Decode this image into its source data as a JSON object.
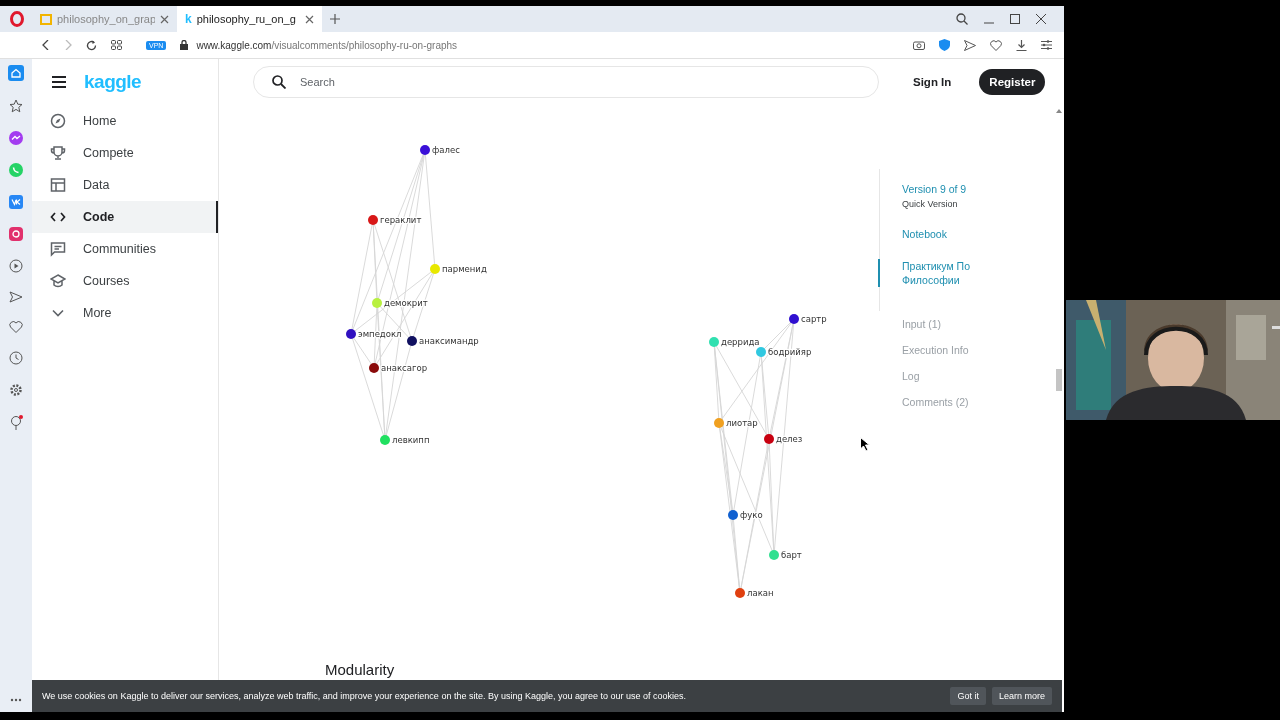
{
  "browser": {
    "tabs": [
      {
        "title": "philosophy_on_grap",
        "selected": false
      },
      {
        "title": "philosophy_ru_on_g",
        "selected": true,
        "favicon_letter": "k"
      }
    ],
    "vpn_badge": "VPN",
    "address": {
      "domain": "www.kaggle.com",
      "path": "/visualcomments/philosophy-ru-on-graphs"
    }
  },
  "kaggle": {
    "logo": "kaggle",
    "search": {
      "placeholder": "Search"
    },
    "sign_in": "Sign In",
    "register": "Register",
    "nav": [
      {
        "label": "Home",
        "selected": false
      },
      {
        "label": "Compete",
        "selected": false
      },
      {
        "label": "Data",
        "selected": false
      },
      {
        "label": "Code",
        "selected": true
      },
      {
        "label": "Communities",
        "selected": false
      },
      {
        "label": "Courses",
        "selected": false
      },
      {
        "label": "More",
        "selected": false
      }
    ]
  },
  "graphs": [
    {
      "nodes": [
        {
          "label": "фалес",
          "color": "#3a10d8"
        },
        {
          "label": "гераклит",
          "color": "#d81818"
        },
        {
          "label": "парменид",
          "color": "#e8e800"
        },
        {
          "label": "демокрит",
          "color": "#b8f040"
        },
        {
          "label": "эмпедокл",
          "color": "#3010c0"
        },
        {
          "label": "анаксимандр",
          "color": "#101060"
        },
        {
          "label": "анаксагор",
          "color": "#8a0a0a"
        },
        {
          "label": "левкипп",
          "color": "#20e060"
        }
      ]
    },
    {
      "nodes": [
        {
          "label": "сартр",
          "color": "#3010d0"
        },
        {
          "label": "деррида",
          "color": "#30e0b0"
        },
        {
          "label": "бодрийяр",
          "color": "#30c8e0"
        },
        {
          "label": "лиотар",
          "color": "#f0a020"
        },
        {
          "label": "делез",
          "color": "#c80010"
        },
        {
          "label": "фуко",
          "color": "#1060d0"
        },
        {
          "label": "барт",
          "color": "#30e090"
        },
        {
          "label": "лакан",
          "color": "#e04010"
        }
      ]
    }
  ],
  "heading": "Modularity",
  "toc": {
    "version": "Version 9 of 9",
    "version_note": "Quick Version",
    "items": [
      {
        "label": "Notebook",
        "kind": "link",
        "selected": false
      },
      {
        "label": "Практикум По Философии",
        "kind": "link",
        "selected": true
      },
      {
        "label": "Input (1)",
        "kind": "section",
        "selected": false
      },
      {
        "label": "Execution Info",
        "kind": "section",
        "selected": false
      },
      {
        "label": "Log",
        "kind": "section",
        "selected": false
      },
      {
        "label": "Comments (2)",
        "kind": "section",
        "selected": false
      }
    ]
  },
  "cookie": {
    "text": "We use cookies on Kaggle to deliver our services, analyze web traffic, and improve your experience on the site. By using Kaggle, you agree to our use of cookies.",
    "buttons": [
      "Got it",
      "Learn more"
    ]
  }
}
